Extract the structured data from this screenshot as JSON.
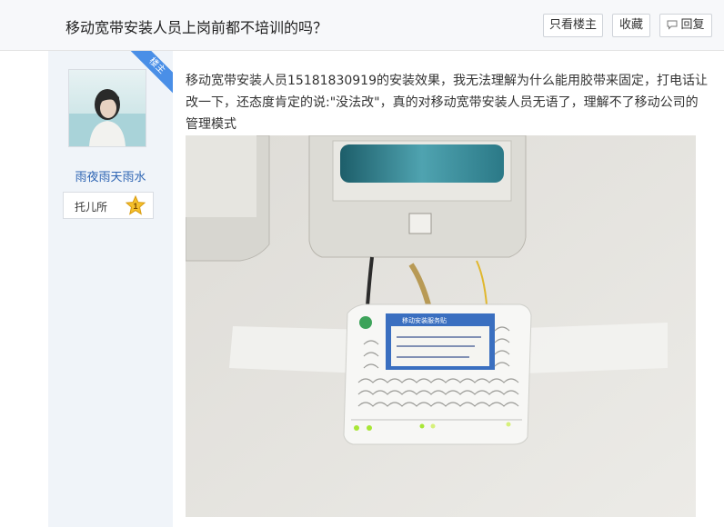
{
  "thread": {
    "title": "移动宽带安装人员上岗前都不培训的吗？"
  },
  "toolbar": {
    "only_op": "只看楼主",
    "favorite": "收藏",
    "reply": "回复"
  },
  "author": {
    "badge": "楼主",
    "name": "雨夜雨天雨水",
    "level_name": "托儿所",
    "level_num": "1"
  },
  "post": {
    "text": "移动宽带安装人员15181830919的安装效果，我无法理解为什么能用胶带来固定，打电话让改一下，还态度肯定的说:\"没法改\"，真的对移动宽带安装人员无语了，理解不了移动公司的管理模式"
  },
  "photo": {
    "label": "移动安装服务贴"
  },
  "colors": {
    "link": "#2d64b3",
    "badge": "#4a8fe7",
    "sidebar": "#f0f4f9",
    "led": "#a8e636"
  }
}
